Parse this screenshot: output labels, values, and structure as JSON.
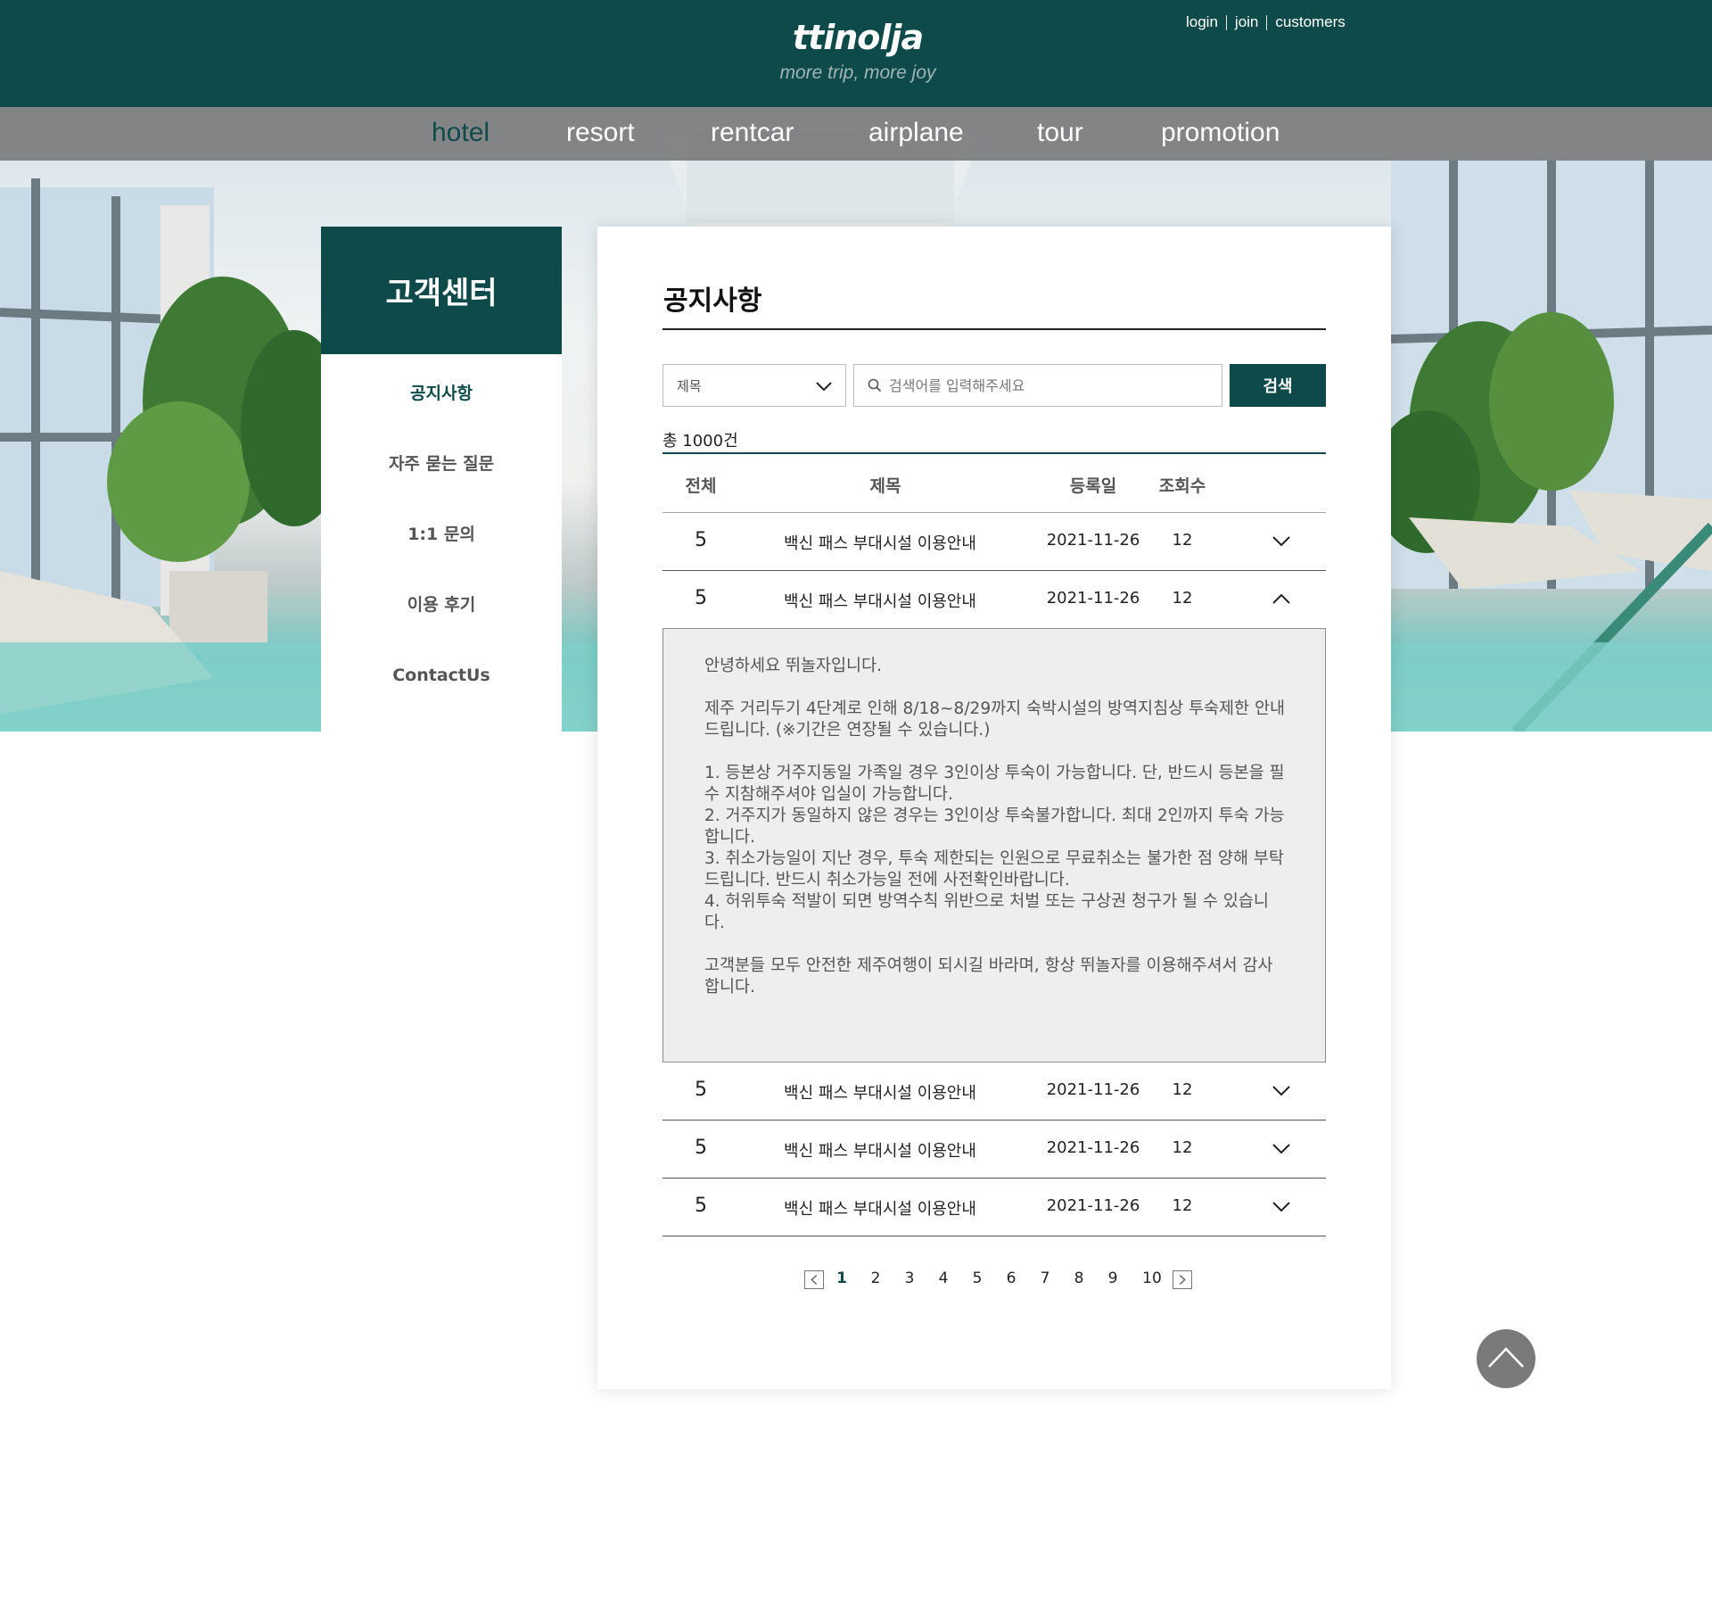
{
  "brand": {
    "logo": "ttinolja",
    "tagline": "more trip, more joy"
  },
  "util_nav": {
    "login": "login",
    "join": "join",
    "customers": "customers"
  },
  "main_nav": [
    {
      "label": "hotel",
      "active": true
    },
    {
      "label": "resort",
      "active": false
    },
    {
      "label": "rentcar",
      "active": false
    },
    {
      "label": "airplane",
      "active": false
    },
    {
      "label": "tour",
      "active": false
    },
    {
      "label": "promotion",
      "active": false
    }
  ],
  "sidebar": {
    "title": "고객센터",
    "items": [
      {
        "label": "공지사항",
        "active": true
      },
      {
        "label": "자주 묻는 질문",
        "active": false
      },
      {
        "label": "1:1 문의",
        "active": false
      },
      {
        "label": "이용 후기",
        "active": false
      },
      {
        "label": "ContactUs",
        "active": false
      }
    ]
  },
  "notice": {
    "title": "공지사항",
    "search": {
      "select_value": "제목",
      "placeholder": "검색어를 입력해주세요",
      "button_label": "검색"
    },
    "total": "총 1000건",
    "columns": [
      "전체",
      "제목",
      "등록일",
      "조회수"
    ],
    "rows": [
      {
        "num": "5",
        "title": "백신 패스 부대시설 이용안내",
        "date": "2021-11-26",
        "views": "12",
        "expanded": false
      },
      {
        "num": "5",
        "title": "백신 패스 부대시설 이용안내",
        "date": "2021-11-26",
        "views": "12",
        "expanded": true
      },
      {
        "num": "5",
        "title": "백신 패스 부대시설 이용안내",
        "date": "2021-11-26",
        "views": "12",
        "expanded": false
      },
      {
        "num": "5",
        "title": "백신 패스 부대시설 이용안내",
        "date": "2021-11-26",
        "views": "12",
        "expanded": false
      },
      {
        "num": "5",
        "title": "백신 패스 부대시설 이용안내",
        "date": "2021-11-26",
        "views": "12",
        "expanded": false
      }
    ],
    "detail": {
      "greeting": "안녕하세요 뛰놀자입니다.",
      "intro": "제주 거리두기 4단계로 인해 8/18~8/29까지 숙박시설의 방역지침상 투숙제한 안내드립니다. (※기간은 연장될 수 있습니다.)",
      "items": [
        "1. 등본상 거주지동일 가족일 경우 3인이상 투숙이 가능합니다. 단, 반드시 등본을 필수 지참해주셔야 입실이 가능합니다.",
        "2. 거주지가 동일하지 않은 경우는 3인이상 투숙불가합니다. 최대 2인까지 투숙 가능합니다.",
        "3. 취소가능일이 지난 경우, 투숙 제한되는 인원으로 무료취소는 불가한 점 양해 부탁드립니다. 반드시 취소가능일 전에 사전확인바랍니다.",
        "4. 허위투숙 적발이 되면 방역수칙 위반으로 처벌 또는 구상권 청구가 될 수 있습니다."
      ],
      "closing": "고객분들 모두 안전한 제주여행이 되시길 바라며, 항상 뛰놀자를 이용해주셔서 감사합니다."
    },
    "pagination": {
      "pages": [
        "1",
        "2",
        "3",
        "4",
        "5",
        "6",
        "7",
        "8",
        "9",
        "10"
      ],
      "current": "1"
    }
  },
  "colors": {
    "brand": "#0f4a4b",
    "nav_bar": "#6e6e6e",
    "top_button": "#7a7a7a"
  },
  "icons": [
    "chevron-down-icon",
    "chevron-up-icon",
    "search-icon",
    "prev-page-icon",
    "next-page-icon",
    "arrow-up-icon"
  ]
}
